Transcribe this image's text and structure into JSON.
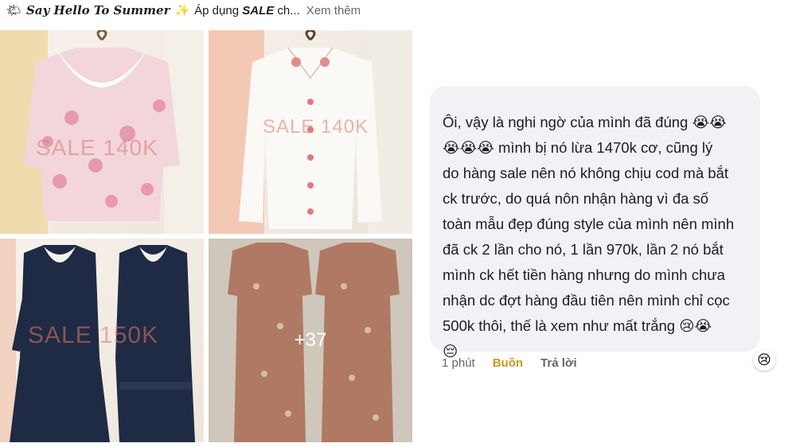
{
  "post": {
    "header_emoji": "🌤",
    "title": "Say Hello To Summer",
    "sparkle": "✨",
    "text_prefix": "Áp dụng",
    "text_sale": "SALE",
    "text_suffix": "ch...",
    "see_more": "Xem thêm"
  },
  "photos": [
    {
      "sale_label": "SALE 140K",
      "icon": "floral-collar-blouse"
    },
    {
      "sale_label": "SALE 140K",
      "icon": "white-embroidered-blouse"
    },
    {
      "sale_label": "SALE 150K",
      "icon": "navy-lace-collar-dress"
    },
    {
      "sale_label": "",
      "icon": "floral-shirt-dress",
      "more_count": "+37"
    }
  ],
  "comment": {
    "text": "Ôi, vậy là nghi ngờ của mình đã đúng 😭😭\n😭😭😭 mình bị nó lừa 1470k cơ, cũng lý\ndo hàng sale nên nó không chịu cod mà bắt\nck trước, do quá nôn nhận hàng vì đa số\ntoàn mẫu đẹp đúng style của mình nên mình\nđã ck 2 lần cho nó, 1 lần 970k, lần 2 nó bắt\nmình ck hết tiền hàng nhưng do mình chưa\nnhận dc đợt hàng đầu tiên nên mình chỉ cọc\n500k thôi, thế là xem như mất trắng 😢😭\n😔",
    "time": "1 phút",
    "reaction_label": "Buồn",
    "reply_label": "Trả lời",
    "reaction_badge": "😢"
  },
  "colors": {
    "bubble": "#f0f2f5",
    "reaction": "#c79a1e",
    "muted": "#65676b"
  }
}
